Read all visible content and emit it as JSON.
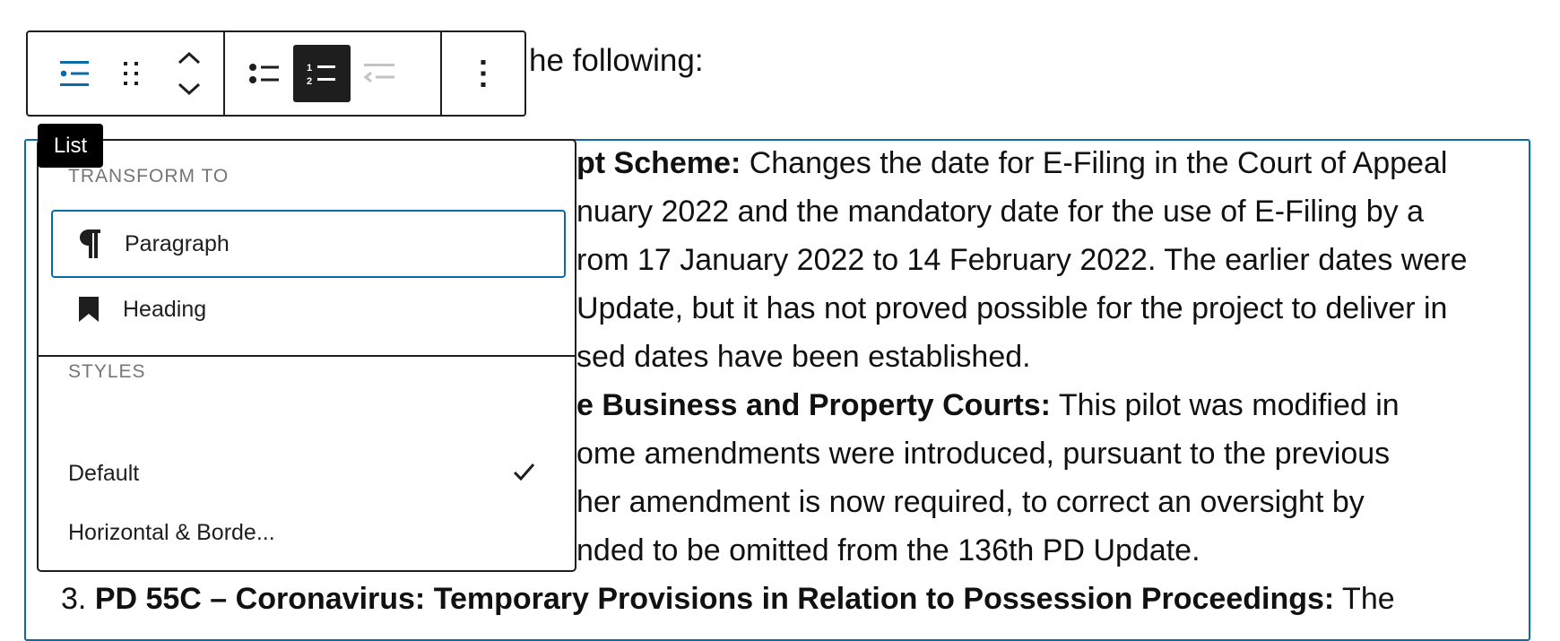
{
  "editor": {
    "intro_fragment": "he following:",
    "list_lines": [
      {
        "bold": "pt Scheme:",
        "text": "  Changes the date for E-Filing in the Court of Appeal"
      },
      {
        "bold": "",
        "text": "nuary 2022 and the mandatory date for the use of E-Filing by a"
      },
      {
        "bold": "",
        "text": "rom 17 January 2022 to 14 February 2022. The earlier dates were"
      },
      {
        "bold": "",
        "text": "Update, but it has not proved possible for the project to deliver in"
      },
      {
        "bold": "",
        "text": "sed dates have been established."
      },
      {
        "bold": "e Business and Property Courts:",
        "text": " This pilot was modified in"
      },
      {
        "bold": "",
        "text": "ome amendments were introduced, pursuant to the previous"
      },
      {
        "bold": "",
        "text": "her amendment is now required, to correct an oversight by"
      },
      {
        "bold": "",
        "text": "nded to be omitted from the 136th PD Update."
      }
    ],
    "item3": {
      "number": "3.",
      "bold": "PD 55C – Coronavirus: Temporary Provisions in Relation to Possession Proceedings:",
      "text": " The"
    }
  },
  "toolbar": {
    "buttons": [
      {
        "name": "block-type-list",
        "icon": "list-block-icon",
        "active_color": "#0a6ba8"
      },
      {
        "name": "drag-handle",
        "icon": "drag-handle-icon"
      },
      {
        "name": "move-up-down",
        "icon": "chevron-up-down-icon"
      },
      {
        "name": "unordered-list",
        "icon": "bulleted-list-icon"
      },
      {
        "name": "ordered-list",
        "icon": "numbered-list-icon",
        "pressed": true
      },
      {
        "name": "outdent",
        "icon": "outdent-icon",
        "disabled": true
      },
      {
        "name": "more-options",
        "icon": "vertical-ellipsis-icon"
      }
    ]
  },
  "tooltip": {
    "label": "List"
  },
  "popover": {
    "transform_title": "TRANSFORM TO",
    "transform_items": [
      {
        "label": "Paragraph",
        "icon": "paragraph-icon",
        "focused": true
      },
      {
        "label": "Heading",
        "icon": "heading-bookmark-icon"
      }
    ],
    "styles_title": "STYLES",
    "style_items": [
      {
        "label": "Default",
        "selected": true
      },
      {
        "label": "Horizontal & Borde..."
      }
    ]
  },
  "colors": {
    "accent": "#0a6ba8",
    "text": "#1e1e1e",
    "muted": "#757575",
    "disabled": "#c3c3c3"
  }
}
